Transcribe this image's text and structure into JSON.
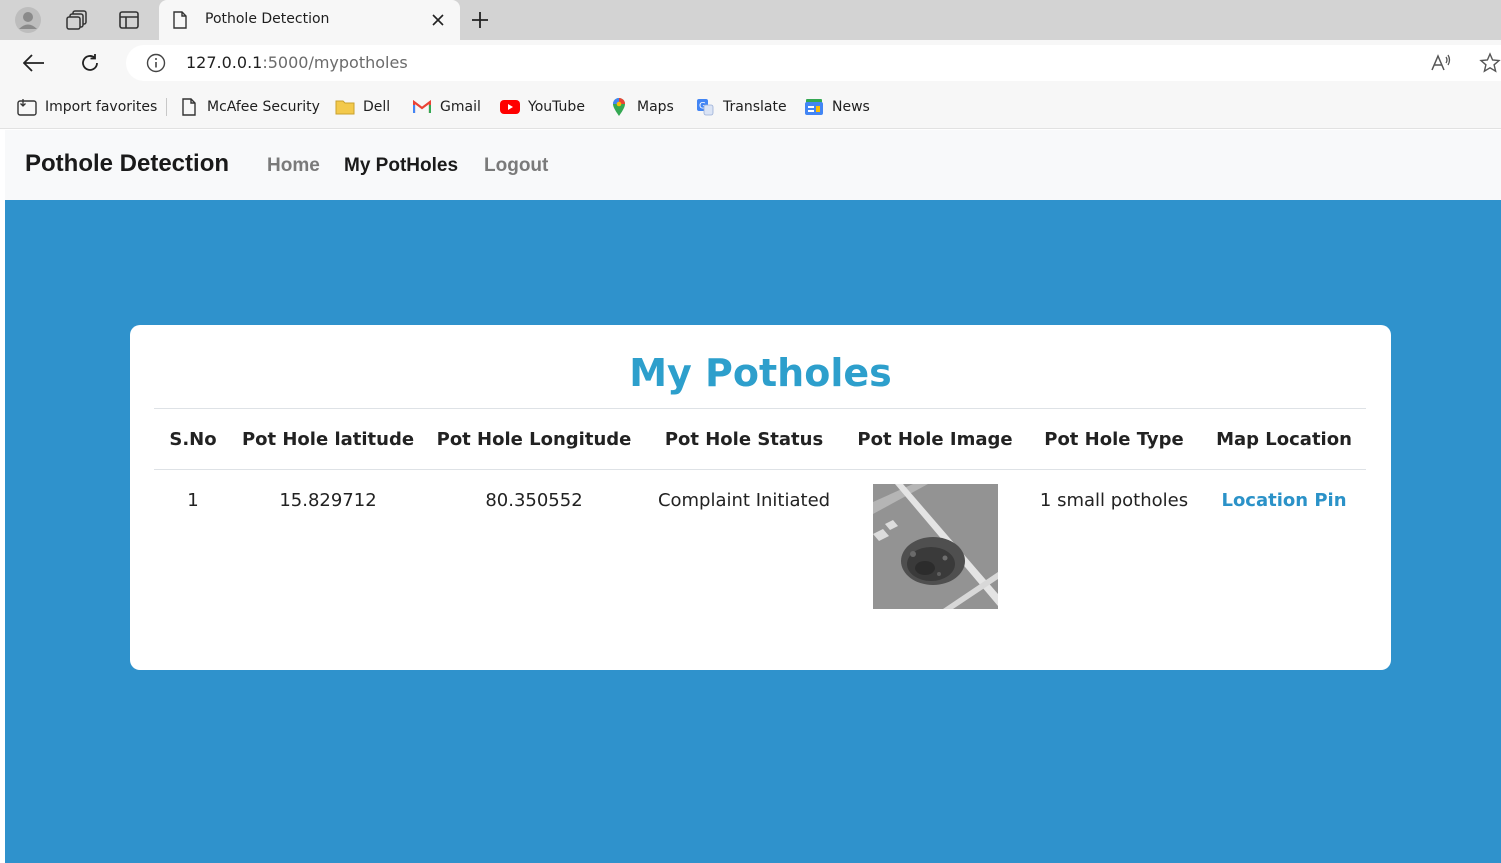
{
  "browser": {
    "tab_title": "Pothole Detection",
    "url_host": "127.0.0.1",
    "url_path": ":5000/mypotholes",
    "favorites": [
      {
        "label": "Import favorites",
        "icon": "import-favorites-icon"
      },
      {
        "label": "McAfee Security",
        "icon": "document-icon"
      },
      {
        "label": "Dell",
        "icon": "folder-icon"
      },
      {
        "label": "Gmail",
        "icon": "gmail-icon"
      },
      {
        "label": "YouTube",
        "icon": "youtube-icon"
      },
      {
        "label": "Maps",
        "icon": "maps-pin-icon"
      },
      {
        "label": "Translate",
        "icon": "translate-icon"
      },
      {
        "label": "News",
        "icon": "news-icon"
      }
    ]
  },
  "app": {
    "brand": "Pothole Detection",
    "nav": {
      "home": "Home",
      "my_potholes": "My PotHoles",
      "logout": "Logout"
    }
  },
  "page": {
    "title": "My Potholes",
    "columns": [
      "S.No",
      "Pot Hole latitude",
      "Pot Hole Longitude",
      "Pot Hole Status",
      "Pot Hole Image",
      "Pot Hole Type",
      "Map Location"
    ],
    "rows": [
      {
        "sno": "1",
        "latitude": "15.829712",
        "longitude": "80.350552",
        "status": "Complaint Initiated",
        "type": "1 small potholes",
        "map_link": "Location Pin"
      }
    ]
  },
  "colors": {
    "page_background": "#2f92cc",
    "title_accent": "#2d9fcc",
    "link": "#2b92c8"
  }
}
